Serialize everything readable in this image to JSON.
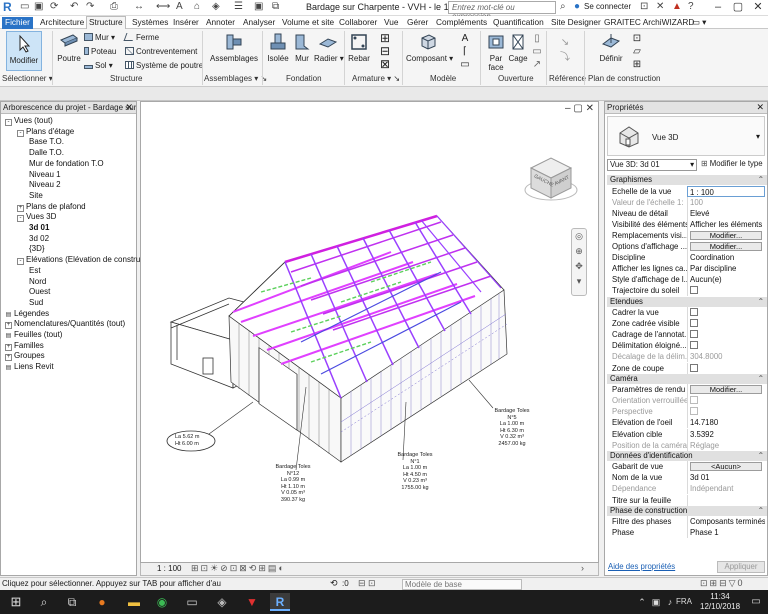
{
  "titlebar": {
    "doc_title": "Bardage sur Charpente - VVH - le 12-...",
    "search_placeholder": "Entrez mot-clé ou expression",
    "connect": "Se connecter",
    "help": "?"
  },
  "tabs": [
    "Fichier",
    "Architecture",
    "Structure",
    "Systèmes",
    "Insérer",
    "Annoter",
    "Analyser",
    "Volume et site",
    "Collaborer",
    "Vue",
    "Gérer",
    "Compléments",
    "Quantification",
    "Site Designer",
    "GRAITEC ArchiWIZARD"
  ],
  "ribbon": {
    "modify": "Modifier",
    "beam": "Poutre",
    "wall": "Mur",
    "column": "Poteau",
    "floor": "Sol",
    "truss": "Ferme",
    "bracing": "Contreventement",
    "beam_system": "Système de poutre",
    "assemblies": "Assemblages",
    "isolated": "Isolée",
    "wall_fnd": "Mur",
    "slab": "Radier",
    "rebar": "Rebar",
    "component": "Composant",
    "by_face": "Par face",
    "shaft": "Cage",
    "define": "Définir",
    "groups": {
      "select": "Sélectionner",
      "structure": "Structure",
      "connection": "Assemblages",
      "foundation": "Fondation",
      "reinforcement": "Armature",
      "model": "Modèle",
      "opening": "Ouverture",
      "datum": "Référence",
      "workplane": "Plan de construction"
    }
  },
  "browser": {
    "title": "Arborescence du projet - Bardage sur ...",
    "items": [
      {
        "label": "Vues (tout)",
        "level": 0,
        "toggle": "-"
      },
      {
        "label": "Plans d'étage",
        "level": 1,
        "toggle": "-"
      },
      {
        "label": "Base T.O.",
        "level": 2,
        "toggle": ""
      },
      {
        "label": "Dalle T.O.",
        "level": 2,
        "toggle": ""
      },
      {
        "label": "Mur de fondation T.O",
        "level": 2,
        "toggle": ""
      },
      {
        "label": "Niveau 1",
        "level": 2,
        "toggle": ""
      },
      {
        "label": "Niveau 2",
        "level": 2,
        "toggle": ""
      },
      {
        "label": "Site",
        "level": 2,
        "toggle": ""
      },
      {
        "label": "Plans de plafond",
        "level": 1,
        "toggle": "+"
      },
      {
        "label": "Vues 3D",
        "level": 1,
        "toggle": "-"
      },
      {
        "label": "3d 01",
        "level": 2,
        "toggle": "",
        "bold": true
      },
      {
        "label": "3d 02",
        "level": 2,
        "toggle": ""
      },
      {
        "label": "{3D}",
        "level": 2,
        "toggle": ""
      },
      {
        "label": "Elévations (Elévation de constructi",
        "level": 1,
        "toggle": "-"
      },
      {
        "label": "Est",
        "level": 2,
        "toggle": ""
      },
      {
        "label": "Nord",
        "level": 2,
        "toggle": ""
      },
      {
        "label": "Ouest",
        "level": 2,
        "toggle": ""
      },
      {
        "label": "Sud",
        "level": 2,
        "toggle": ""
      },
      {
        "label": "Légendes",
        "level": 0,
        "toggle": ""
      },
      {
        "label": "Nomenclatures/Quantités (tout)",
        "level": 0,
        "toggle": "+"
      },
      {
        "label": "Feuilles (tout)",
        "level": 0,
        "toggle": ""
      },
      {
        "label": "Familles",
        "level": 0,
        "toggle": "+"
      },
      {
        "label": "Groupes",
        "level": 0,
        "toggle": "+"
      },
      {
        "label": "Liens Revit",
        "level": 0,
        "toggle": ""
      }
    ]
  },
  "viewcube": {
    "left": "GAUCHE",
    "front": "AVANT"
  },
  "annotations": {
    "bubble": [
      "La 5.62 m",
      "Ht 6.00 m"
    ],
    "tag12": [
      "Bardage Toles",
      "N°12",
      "La 0.99 m",
      "Ht 1.10 m",
      "V 0.05 m³",
      "390.37 kg"
    ],
    "tag1": [
      "Bardage Toles",
      "N°1",
      "La 1.00 m",
      "Ht 4.50 m",
      "V 0.23 m³",
      "1755.00 kg"
    ],
    "tag5": [
      "Bardage Toles",
      "N°5",
      "La 1.00 m",
      "Ht 6.30 m",
      "V 0.32 m³",
      "2457.00 kg"
    ]
  },
  "viewbar": {
    "scale": "1 : 100"
  },
  "properties": {
    "title": "Propriétés",
    "type_name": "Vue 3D",
    "instance": "Vue 3D: 3d 01",
    "edit_type": "Modifier le type",
    "sections": {
      "graphics": "Graphismes",
      "extents": "Etendues",
      "camera": "Caméra",
      "identity": "Données d'identification",
      "phasing": "Phase de construction"
    },
    "rows": {
      "scale": [
        "Echelle de la vue",
        "1 : 100"
      ],
      "scale_value": [
        "Valeur de l'échelle    1:",
        "100"
      ],
      "detail": [
        "Niveau de détail",
        "Elevé"
      ],
      "visibility": [
        "Visibilité des éléments",
        "Afficher les éléments"
      ],
      "overrides": [
        "Remplacements visi...",
        "Modifier..."
      ],
      "display": [
        "Options d'affichage ...",
        "Modifier..."
      ],
      "discipline": [
        "Discipline",
        "Coordination"
      ],
      "hidden": [
        "Afficher les lignes ca...",
        "Par discipline"
      ],
      "style": [
        "Style d'affichage de l...",
        "Aucun(e)"
      ],
      "sunpath": [
        "Trajectoire du soleil",
        ""
      ],
      "crop": [
        "Cadrer la vue",
        ""
      ],
      "crop_visible": [
        "Zone cadrée visible",
        ""
      ],
      "annot_crop": [
        "Cadrage de l'annotat...",
        ""
      ],
      "far_clip": [
        "Délimitation éloigné...",
        ""
      ],
      "far_offset": [
        "Décalage de la délim...",
        "304.8000"
      ],
      "section_box": [
        "Zone de coupe",
        ""
      ],
      "render": [
        "Paramètres de rendu",
        "Modifier..."
      ],
      "locked": [
        "Orientation verrouillée",
        ""
      ],
      "perspective": [
        "Perspective",
        ""
      ],
      "eye": [
        "Elévation de l'oeil",
        "14.7180"
      ],
      "target": [
        "Elévation cible",
        "3.5392"
      ],
      "cam_pos": [
        "Position de la caméra",
        "Réglage"
      ],
      "template": [
        "Gabarit de vue",
        "<Aucun>"
      ],
      "view_name": [
        "Nom de la vue",
        "3d 01"
      ],
      "dependency": [
        "Dépendance",
        "Indépendant"
      ],
      "sheet_title": [
        "Titre sur la feuille",
        ""
      ],
      "phase_filter": [
        "Filtre des phases",
        "Composants terminés"
      ],
      "phase": [
        "Phase",
        "Phase 1"
      ]
    },
    "help_link": "Aide des propriétés",
    "apply": "Appliquer"
  },
  "status": {
    "message": "Cliquez pour sélectionner. Appuyez sur TAB pour afficher d'au",
    "zero": ":0",
    "model": "Modèle de base"
  },
  "taskbar": {
    "time": "11:34",
    "date": "12/10/2018",
    "lang": "FRA"
  }
}
